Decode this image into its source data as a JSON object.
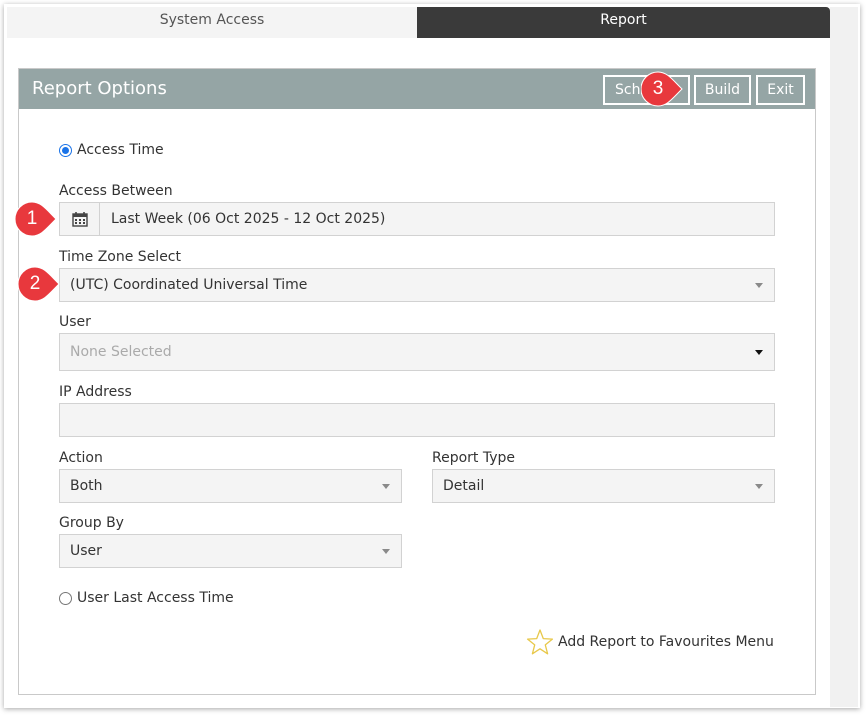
{
  "tabs": [
    {
      "label": "System Access"
    },
    {
      "label": "Report"
    }
  ],
  "panel": {
    "title": "Report Options",
    "buttons": {
      "schedule": "Sch",
      "build": "Build",
      "exit": "Exit"
    }
  },
  "form": {
    "access_time_label": "Access Time",
    "access_between": {
      "label": "Access Between",
      "value": "Last Week (06 Oct 2025 - 12 Oct 2025)",
      "icon": "calendar-icon"
    },
    "time_zone": {
      "label": "Time Zone Select",
      "value": "(UTC) Coordinated Universal Time"
    },
    "user": {
      "label": "User",
      "value": "None Selected"
    },
    "ip_address": {
      "label": "IP Address",
      "value": ""
    },
    "action": {
      "label": "Action",
      "value": "Both"
    },
    "report_type": {
      "label": "Report Type",
      "value": "Detail"
    },
    "group_by": {
      "label": "Group By",
      "value": "User"
    },
    "user_last_access_label": "User Last Access Time",
    "favourites_label": "Add Report to Favourites Menu"
  },
  "markers": [
    "1",
    "2",
    "3"
  ],
  "colors": {
    "header": "#95a5a5",
    "active_tab": "#3a3a3a",
    "radio_accent": "#1a73e8",
    "marker": "#e8383d",
    "star": "#e8c84a"
  }
}
